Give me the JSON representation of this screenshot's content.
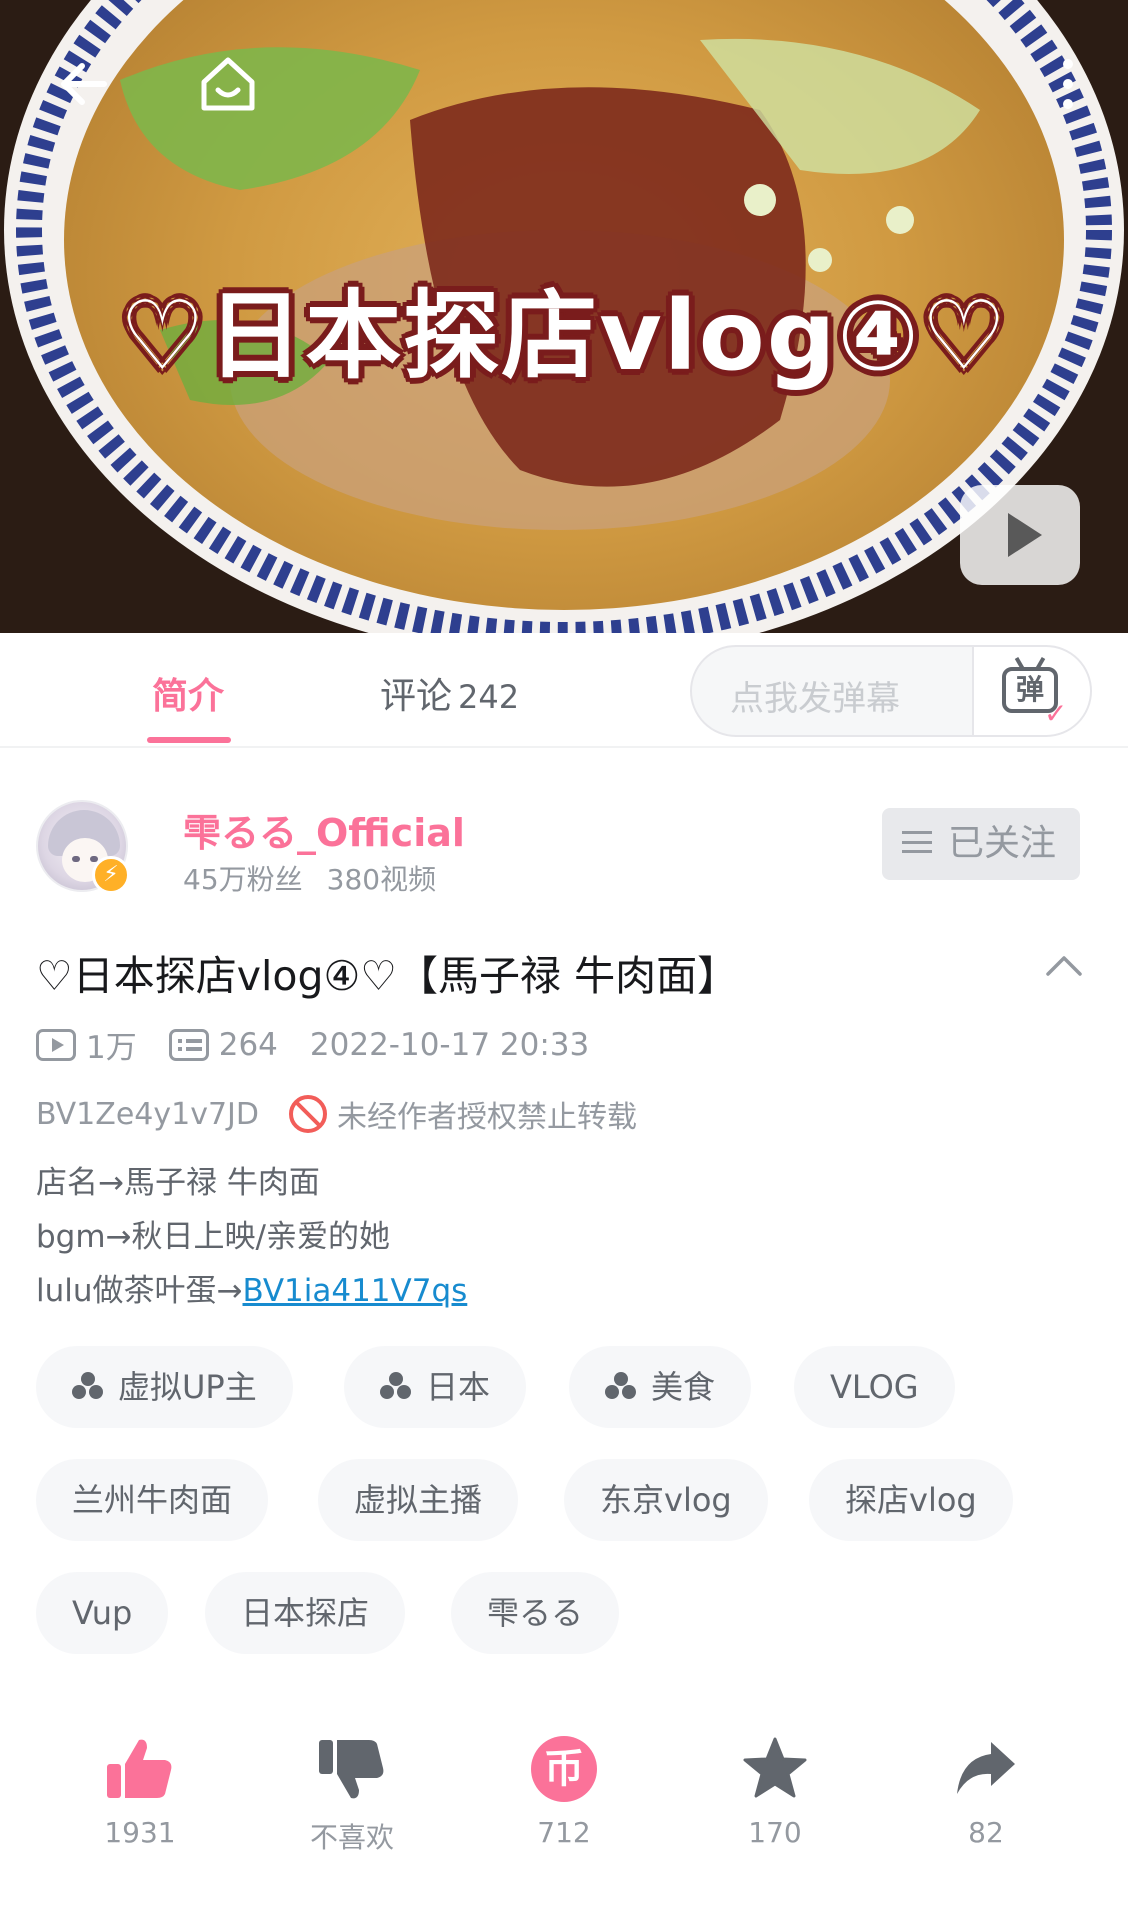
{
  "cover": {
    "title_text": "♡日本探店vlog④♡"
  },
  "tabs": {
    "intro_label": "简介",
    "comments_label": "评论",
    "comments_count": "242",
    "danmaku_placeholder": "点我发弹幕",
    "danmaku_button_glyph": "弹"
  },
  "uploader": {
    "name": "雫るる_Official",
    "fans": "45万粉丝",
    "videos": "380视频",
    "follow_label": "已关注"
  },
  "video": {
    "title": "♡日本探店vlog④♡【馬子禄 牛肉面】",
    "plays": "1万",
    "danmaku_count": "264",
    "published": "2022-10-17 20:33",
    "bvid": "BV1Ze4y1v7JD",
    "copyright_notice": "未经作者授权禁止转载",
    "description": {
      "line1": "店名→馬子禄 牛肉面",
      "line2": "bgm→秋日上映/亲爱的她",
      "line3_prefix": "lulu做茶叶蛋→",
      "line3_link": "BV1ia411V7qs"
    }
  },
  "tags": [
    "虚拟UP主",
    "日本",
    "美食",
    "VLOG",
    "兰州牛肉面",
    "虚拟主播",
    "东京vlog",
    "探店vlog",
    "Vup",
    "日本探店",
    "雫るる"
  ],
  "actions": {
    "like_count": "1931",
    "dislike_label": "不喜欢",
    "coin_count": "712",
    "coin_glyph": "币",
    "favorite_count": "170",
    "share_count": "82"
  },
  "colors": {
    "accent": "#fb7299",
    "muted": "#9499a0",
    "link": "#178bcf",
    "follow_bg": "#e8e9ec",
    "tag_bg": "#f6f7f9"
  },
  "icons": [
    "back-icon",
    "home-icon",
    "more-icon",
    "play-icon",
    "danmaku-tv-icon",
    "collapse-icon",
    "view-count-icon",
    "danmaku-count-icon",
    "no-repost-icon",
    "channel-icon",
    "thumbs-up-icon",
    "thumbs-down-icon",
    "coin-icon",
    "star-icon",
    "share-icon",
    "lightning-icon"
  ]
}
